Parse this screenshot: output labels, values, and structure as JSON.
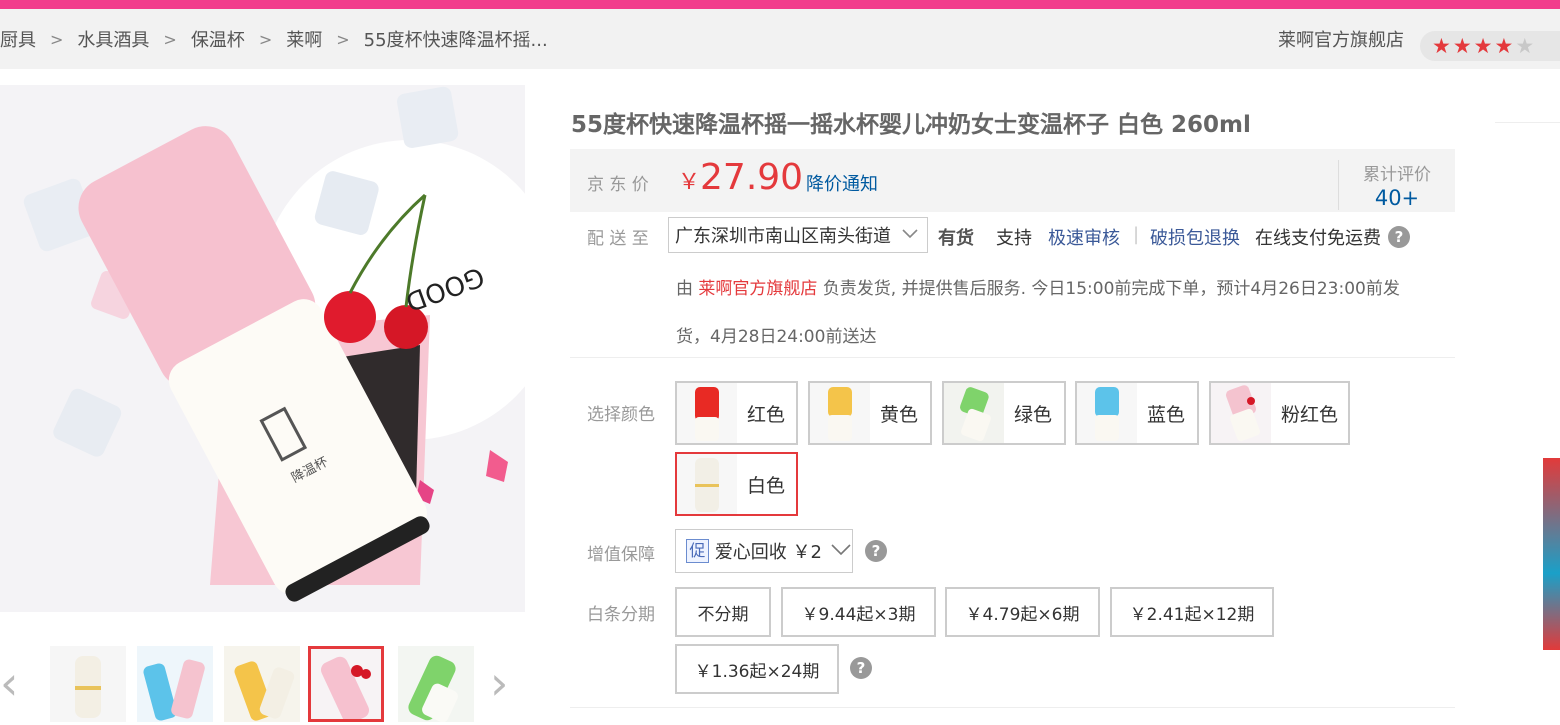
{
  "breadcrumb": [
    "厨具",
    "水具酒具",
    "保温杯",
    "莱啊",
    "55度杯快速降温杯摇..."
  ],
  "store": {
    "name": "莱啊官方旗舰店",
    "rating": 4,
    "rating_max": 5
  },
  "product": {
    "title": "55度杯快速降温杯摇一摇水杯婴儿冲奶女士变温杯子 白色 260ml",
    "price_label": "京 东 价",
    "price_symbol": "￥",
    "price": "27.90",
    "price_notice": "降价通知",
    "review_label": "累计评价",
    "review_count": "40+"
  },
  "delivery": {
    "label": "配 送 至",
    "address": "广东深圳市南山区南头街道",
    "stock": "有货",
    "support": "支持",
    "links": [
      "极速审核",
      "破损包退换"
    ],
    "free_ship": "在线支付免运费",
    "info_prefix": "由",
    "info_shop": "莱啊官方旗舰店",
    "info_line1": "负责发货, 并提供售后服务. 今日15:00前完成下单，预计4月26日23:00前发",
    "info_line2": "货，4月28日24:00前送达"
  },
  "colors": {
    "label": "选择颜色",
    "options": [
      "红色",
      "黄色",
      "绿色",
      "蓝色",
      "粉红色",
      "白色"
    ],
    "selected": "白色",
    "swatch_colors": [
      "#e82a24",
      "#f4c44a",
      "#7fd36b",
      "#5cc3ea",
      "#f4c3cf",
      "#f2efe6"
    ]
  },
  "value_added": {
    "label": "增值保障",
    "badge": "促",
    "text": "爱心回收 ￥2"
  },
  "installment": {
    "label": "白条分期",
    "options": [
      "不分期",
      "￥9.44起×3期",
      "￥4.79起×6期",
      "￥2.41起×12期",
      "￥1.36起×24期"
    ]
  },
  "accent": {
    "brand_pink": "#f23c8c",
    "price_red": "#e4393c",
    "link_blue": "#005aa0"
  }
}
